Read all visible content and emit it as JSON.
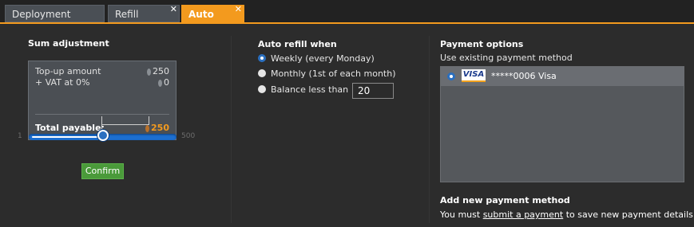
{
  "tabs": [
    {
      "label": "Deployment manager"
    },
    {
      "label": "Refill balance"
    },
    {
      "label": "Auto refill"
    }
  ],
  "sum_adjustment": {
    "title": "Sum adjustment",
    "topup_label": "Top-up amount",
    "topup_value": "250",
    "vat_label": "+ VAT at 0%",
    "vat_value": "0",
    "total_label": "Total payable:",
    "total_value": "250",
    "slider": {
      "min": "1",
      "max": "500",
      "value_fraction": 0.5
    },
    "confirm_label": "Confirm"
  },
  "auto_refill": {
    "title": "Auto refill when",
    "options": [
      {
        "label": "Weekly (every Monday)",
        "selected": true
      },
      {
        "label": "Monthly (1st of each month)",
        "selected": false
      },
      {
        "label": "Balance less than",
        "selected": false
      }
    ],
    "balance_threshold": "20"
  },
  "payment": {
    "title": "Payment options",
    "subtitle": "Use existing payment method",
    "card_brand": "VISA",
    "card_text": "*****0006 Visa",
    "add_title": "Add new payment method",
    "add_text_before": "You must ",
    "add_link": "submit a payment",
    "add_text_after": " to save new payment details"
  },
  "colors": {
    "accent": "#f39a1e",
    "confirm": "#4a9a3a",
    "slider": "#1d6fd0"
  }
}
